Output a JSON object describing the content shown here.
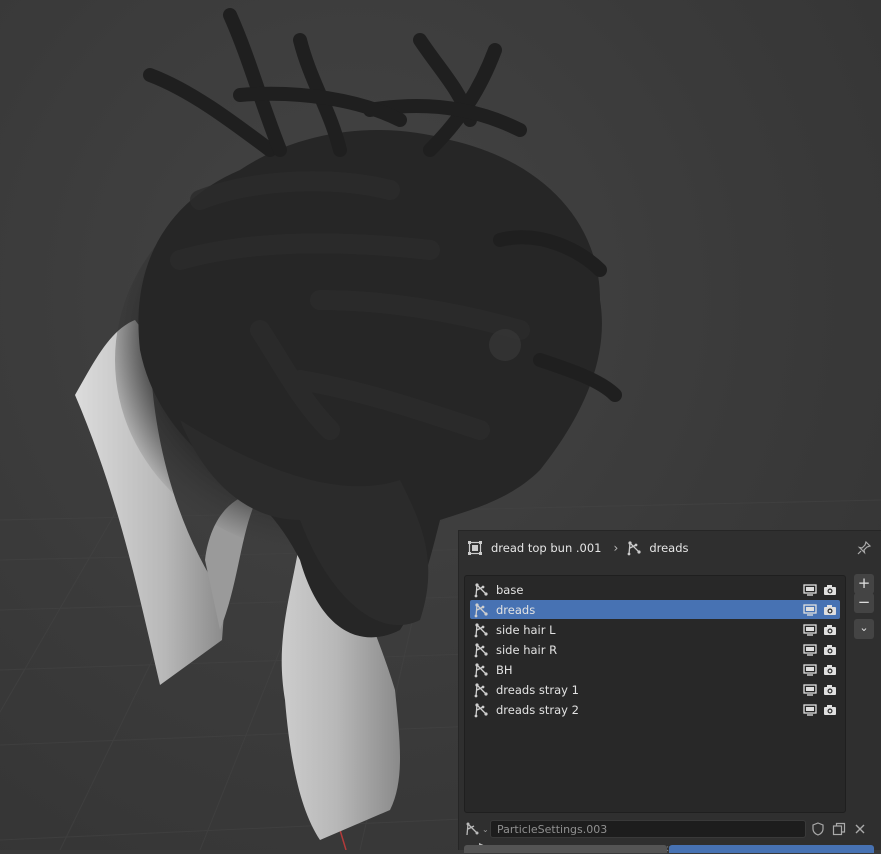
{
  "header": {
    "object_name": "dread top bun .001",
    "system_name": "dreads"
  },
  "particle_systems": [
    {
      "name": "base",
      "selected": false
    },
    {
      "name": "dreads",
      "selected": true
    },
    {
      "name": "side hair L",
      "selected": false
    },
    {
      "name": "side hair R",
      "selected": false
    },
    {
      "name": "BH",
      "selected": false
    },
    {
      "name": "dreads stray 1",
      "selected": false
    },
    {
      "name": "dreads stray 2",
      "selected": false
    }
  ],
  "list_buttons": {
    "add": "+",
    "remove": "−",
    "menu": "⌄"
  },
  "settings": {
    "value": "ParticleSettings.003"
  },
  "colors": {
    "accent": "#4772b3",
    "panel": "#2f2f2f",
    "list_bg": "#282828"
  }
}
